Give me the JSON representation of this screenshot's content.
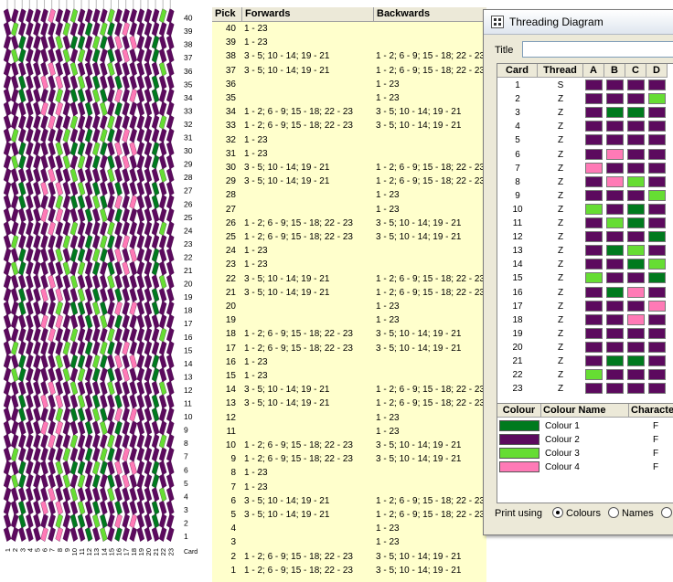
{
  "pattern": {
    "pick_labels": [
      "1",
      "2",
      "3",
      "4",
      "5",
      "6",
      "7",
      "8",
      "9",
      "10",
      "11",
      "12",
      "13",
      "14",
      "15",
      "16",
      "17",
      "18",
      "19",
      "20",
      "21",
      "22",
      "23",
      "24",
      "25",
      "26",
      "27",
      "28",
      "29",
      "30",
      "31",
      "32",
      "33",
      "34",
      "35",
      "36",
      "37",
      "38",
      "39",
      "40"
    ],
    "card_labels": [
      "1",
      "2",
      "3",
      "4",
      "5",
      "6",
      "7",
      "8",
      "9",
      "10",
      "11",
      "12",
      "13",
      "14",
      "15",
      "16",
      "17",
      "18",
      "19",
      "20",
      "21",
      "22",
      "23"
    ],
    "card_axis_label": "Card"
  },
  "pick_table": {
    "headers": {
      "pick": "Pick",
      "forwards": "Forwards",
      "backwards": "Backwards"
    },
    "rows": [
      {
        "pick": "40",
        "forwards": "1 - 23",
        "backwards": ""
      },
      {
        "pick": "39",
        "forwards": "1 - 23",
        "backwards": ""
      },
      {
        "pick": "38",
        "forwards": "3 - 5; 10 - 14; 19 - 21",
        "backwards": "1 - 2; 6 - 9; 15 - 18; 22 - 23"
      },
      {
        "pick": "37",
        "forwards": "3 - 5; 10 - 14; 19 - 21",
        "backwards": "1 - 2; 6 - 9; 15 - 18; 22 - 23"
      },
      {
        "pick": "36",
        "forwards": "",
        "backwards": "1 - 23"
      },
      {
        "pick": "35",
        "forwards": "",
        "backwards": "1 - 23"
      },
      {
        "pick": "34",
        "forwards": "1 - 2; 6 - 9; 15 - 18; 22 - 23",
        "backwards": "3 - 5; 10 - 14; 19 - 21"
      },
      {
        "pick": "33",
        "forwards": "1 - 2; 6 - 9; 15 - 18; 22 - 23",
        "backwards": "3 - 5; 10 - 14; 19 - 21"
      },
      {
        "pick": "32",
        "forwards": "1 - 23",
        "backwards": ""
      },
      {
        "pick": "31",
        "forwards": "1 - 23",
        "backwards": ""
      },
      {
        "pick": "30",
        "forwards": "3 - 5; 10 - 14; 19 - 21",
        "backwards": "1 - 2; 6 - 9; 15 - 18; 22 - 23"
      },
      {
        "pick": "29",
        "forwards": "3 - 5; 10 - 14; 19 - 21",
        "backwards": "1 - 2; 6 - 9; 15 - 18; 22 - 23"
      },
      {
        "pick": "28",
        "forwards": "",
        "backwards": "1 - 23"
      },
      {
        "pick": "27",
        "forwards": "",
        "backwards": "1 - 23"
      },
      {
        "pick": "26",
        "forwards": "1 - 2; 6 - 9; 15 - 18; 22 - 23",
        "backwards": "3 - 5; 10 - 14; 19 - 21"
      },
      {
        "pick": "25",
        "forwards": "1 - 2; 6 - 9; 15 - 18; 22 - 23",
        "backwards": "3 - 5; 10 - 14; 19 - 21"
      },
      {
        "pick": "24",
        "forwards": "1 - 23",
        "backwards": ""
      },
      {
        "pick": "23",
        "forwards": "1 - 23",
        "backwards": ""
      },
      {
        "pick": "22",
        "forwards": "3 - 5; 10 - 14; 19 - 21",
        "backwards": "1 - 2; 6 - 9; 15 - 18; 22 - 23"
      },
      {
        "pick": "21",
        "forwards": "3 - 5; 10 - 14; 19 - 21",
        "backwards": "1 - 2; 6 - 9; 15 - 18; 22 - 23"
      },
      {
        "pick": "20",
        "forwards": "",
        "backwards": "1 - 23"
      },
      {
        "pick": "19",
        "forwards": "",
        "backwards": "1 - 23"
      },
      {
        "pick": "18",
        "forwards": "1 - 2; 6 - 9; 15 - 18; 22 - 23",
        "backwards": "3 - 5; 10 - 14; 19 - 21"
      },
      {
        "pick": "17",
        "forwards": "1 - 2; 6 - 9; 15 - 18; 22 - 23",
        "backwards": "3 - 5; 10 - 14; 19 - 21"
      },
      {
        "pick": "16",
        "forwards": "1 - 23",
        "backwards": ""
      },
      {
        "pick": "15",
        "forwards": "1 - 23",
        "backwards": ""
      },
      {
        "pick": "14",
        "forwards": "3 - 5; 10 - 14; 19 - 21",
        "backwards": "1 - 2; 6 - 9; 15 - 18; 22 - 23"
      },
      {
        "pick": "13",
        "forwards": "3 - 5; 10 - 14; 19 - 21",
        "backwards": "1 - 2; 6 - 9; 15 - 18; 22 - 23"
      },
      {
        "pick": "12",
        "forwards": "",
        "backwards": "1 - 23"
      },
      {
        "pick": "11",
        "forwards": "",
        "backwards": "1 - 23"
      },
      {
        "pick": "10",
        "forwards": "1 - 2; 6 - 9; 15 - 18; 22 - 23",
        "backwards": "3 - 5; 10 - 14; 19 - 21"
      },
      {
        "pick": "9",
        "forwards": "1 - 2; 6 - 9; 15 - 18; 22 - 23",
        "backwards": "3 - 5; 10 - 14; 19 - 21"
      },
      {
        "pick": "8",
        "forwards": "1 - 23",
        "backwards": ""
      },
      {
        "pick": "7",
        "forwards": "1 - 23",
        "backwards": ""
      },
      {
        "pick": "6",
        "forwards": "3 - 5; 10 - 14; 19 - 21",
        "backwards": "1 - 2; 6 - 9; 15 - 18; 22 - 23"
      },
      {
        "pick": "5",
        "forwards": "3 - 5; 10 - 14; 19 - 21",
        "backwards": "1 - 2; 6 - 9; 15 - 18; 22 - 23"
      },
      {
        "pick": "4",
        "forwards": "",
        "backwards": "1 - 23"
      },
      {
        "pick": "3",
        "forwards": "",
        "backwards": "1 - 23"
      },
      {
        "pick": "2",
        "forwards": "1 - 2; 6 - 9; 15 - 18; 22 - 23",
        "backwards": "3 - 5; 10 - 14; 19 - 21"
      },
      {
        "pick": "1",
        "forwards": "1 - 2; 6 - 9; 15 - 18; 22 - 23",
        "backwards": "3 - 5; 10 - 14; 19 - 21"
      }
    ]
  },
  "dialog": {
    "title": "Threading Diagram",
    "title_label": "Title",
    "title_value": "",
    "grid_headers": {
      "card": "Card",
      "thread": "Thread",
      "holes": [
        "A",
        "B",
        "C",
        "D"
      ]
    },
    "cards": [
      {
        "card": "1",
        "thread": "S",
        "holes": [
          2,
          2,
          2,
          2
        ]
      },
      {
        "card": "2",
        "thread": "Z",
        "holes": [
          2,
          2,
          2,
          3
        ]
      },
      {
        "card": "3",
        "thread": "Z",
        "holes": [
          2,
          1,
          1,
          2
        ]
      },
      {
        "card": "4",
        "thread": "Z",
        "holes": [
          2,
          2,
          2,
          2
        ]
      },
      {
        "card": "5",
        "thread": "Z",
        "holes": [
          2,
          2,
          2,
          2
        ]
      },
      {
        "card": "6",
        "thread": "Z",
        "holes": [
          2,
          4,
          2,
          2
        ]
      },
      {
        "card": "7",
        "thread": "Z",
        "holes": [
          4,
          2,
          2,
          2
        ]
      },
      {
        "card": "8",
        "thread": "Z",
        "holes": [
          2,
          4,
          3,
          2
        ]
      },
      {
        "card": "9",
        "thread": "Z",
        "holes": [
          2,
          2,
          2,
          3
        ]
      },
      {
        "card": "10",
        "thread": "Z",
        "holes": [
          3,
          2,
          1,
          2
        ]
      },
      {
        "card": "11",
        "thread": "Z",
        "holes": [
          2,
          3,
          1,
          2
        ]
      },
      {
        "card": "12",
        "thread": "Z",
        "holes": [
          2,
          2,
          2,
          1
        ]
      },
      {
        "card": "13",
        "thread": "Z",
        "holes": [
          2,
          1,
          3,
          2
        ]
      },
      {
        "card": "14",
        "thread": "Z",
        "holes": [
          2,
          2,
          1,
          3
        ]
      },
      {
        "card": "15",
        "thread": "Z",
        "holes": [
          3,
          2,
          2,
          1
        ]
      },
      {
        "card": "16",
        "thread": "Z",
        "holes": [
          2,
          1,
          4,
          2
        ]
      },
      {
        "card": "17",
        "thread": "Z",
        "holes": [
          2,
          2,
          2,
          4
        ]
      },
      {
        "card": "18",
        "thread": "Z",
        "holes": [
          2,
          2,
          4,
          2
        ]
      },
      {
        "card": "19",
        "thread": "Z",
        "holes": [
          2,
          2,
          2,
          2
        ]
      },
      {
        "card": "20",
        "thread": "Z",
        "holes": [
          2,
          2,
          2,
          2
        ]
      },
      {
        "card": "21",
        "thread": "Z",
        "holes": [
          2,
          1,
          1,
          2
        ]
      },
      {
        "card": "22",
        "thread": "Z",
        "holes": [
          3,
          2,
          2,
          2
        ]
      },
      {
        "card": "23",
        "thread": "Z",
        "holes": [
          2,
          2,
          2,
          2
        ]
      }
    ],
    "colour_headers": {
      "colour": "Colour",
      "name": "Colour Name",
      "character": "Character"
    },
    "colours": [
      {
        "id": 1,
        "name": "Colour 1",
        "character": "F",
        "hex": "#007a1e"
      },
      {
        "id": 2,
        "name": "Colour 2",
        "character": "F",
        "hex": "#5c0a5e"
      },
      {
        "id": 3,
        "name": "Colour 3",
        "character": "F",
        "hex": "#66dd33"
      },
      {
        "id": 4,
        "name": "Colour 4",
        "character": "F",
        "hex": "#ff7ab6"
      }
    ],
    "print_using_label": "Print using",
    "print_options": [
      {
        "label": "Colours",
        "selected": true
      },
      {
        "label": "Names",
        "selected": false
      },
      {
        "label": "",
        "selected": false
      }
    ]
  }
}
